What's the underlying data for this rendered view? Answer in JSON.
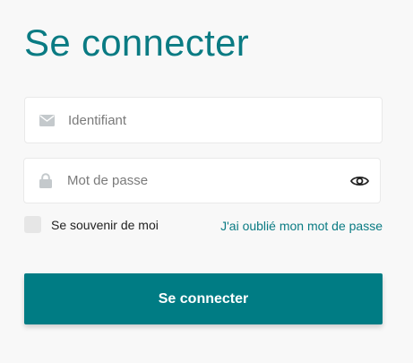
{
  "title": "Se connecter",
  "username": {
    "placeholder": "Identifiant",
    "value": "",
    "icon": "envelope-icon"
  },
  "password": {
    "placeholder": "Mot de passe",
    "value": "",
    "icon": "lock-icon",
    "toggle_icon": "eye-icon"
  },
  "remember_me": {
    "label": "Se souvenir de moi",
    "checked": false
  },
  "forgot_link": "J'ai oublié mon mot de passe",
  "submit_label": "Se connecter",
  "colors": {
    "accent": "#007c84",
    "background": "#f8f8f8",
    "icon_gray": "#c4c9cc"
  }
}
